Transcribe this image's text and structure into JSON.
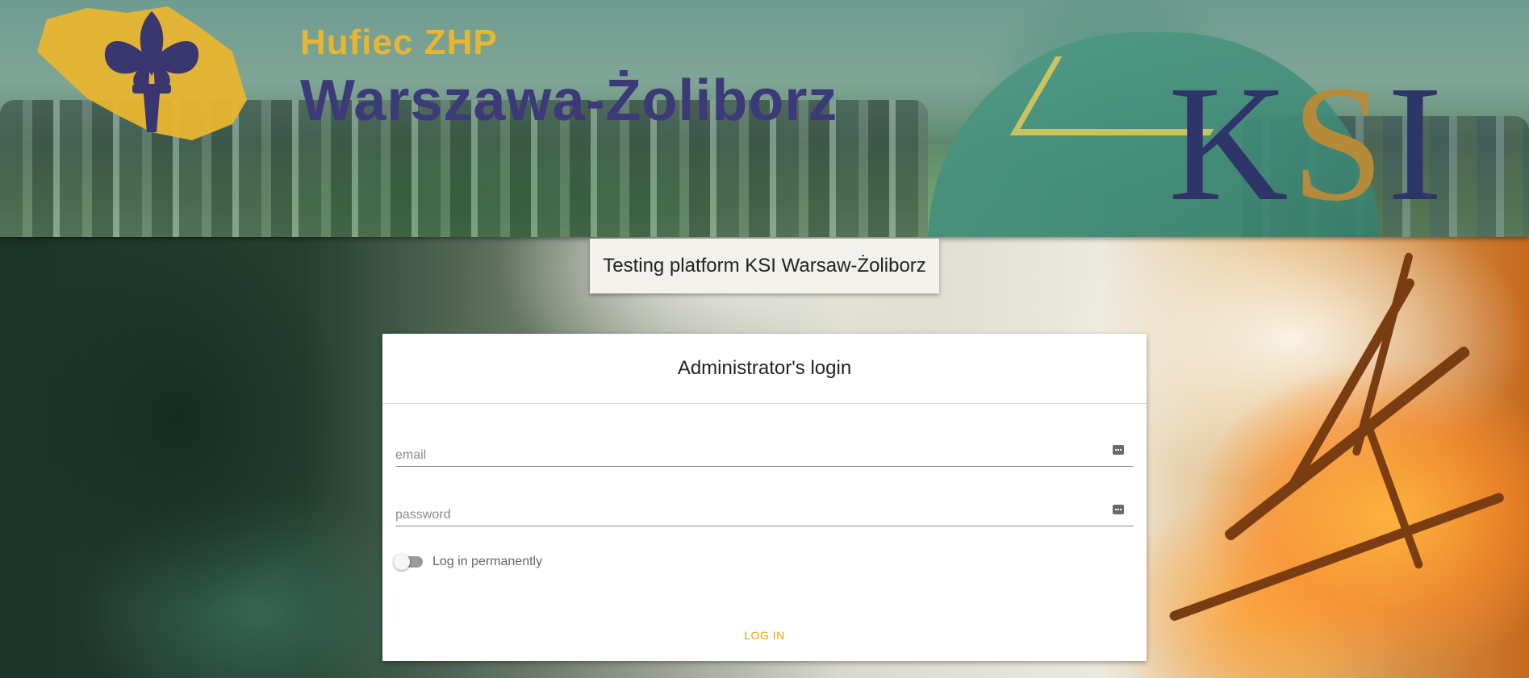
{
  "banner": {
    "org_line": "Hufiec ZHP",
    "city_line": "Warszawa-Żoliborz",
    "brand_k": "K",
    "brand_s": "S",
    "brand_i": "I",
    "logo_icon": "fleur-de-lis-icon",
    "colors": {
      "org": "#e8b530",
      "city": "#3c3a78",
      "brand": "#2f3568",
      "brand_accent": "#b58b3a"
    }
  },
  "platform": {
    "title": "Testing platform KSI Warsaw-Żoliborz"
  },
  "login": {
    "title": "Administrator's login",
    "email": {
      "value": "",
      "placeholder": "email",
      "icon": "password-dots-icon"
    },
    "password": {
      "value": "",
      "placeholder": "password",
      "icon": "password-dots-icon"
    },
    "remember": {
      "label": "Log in permanently",
      "checked": false
    },
    "submit_label": "LOG IN",
    "accent_color": "#e6a400"
  }
}
